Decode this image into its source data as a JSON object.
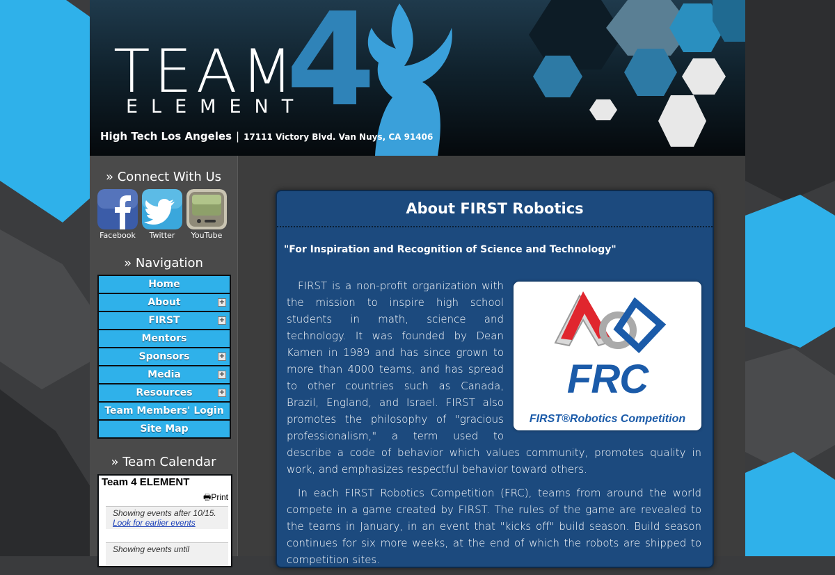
{
  "header": {
    "brand_team": "TEAM",
    "brand_number": "4",
    "brand_element": "ELEMENT",
    "school": "High Tech Los Angeles",
    "separator": "|",
    "address": "17111 Victory Blvd. Van Nuys, CA 91406"
  },
  "sidebar": {
    "connect_heading": "» Connect With Us",
    "social": [
      {
        "label": "Facebook",
        "icon": "facebook-icon"
      },
      {
        "label": "Twitter",
        "icon": "twitter-icon"
      },
      {
        "label": "YouTube",
        "icon": "youtube-icon"
      }
    ],
    "nav_heading": "» Navigation",
    "nav": [
      {
        "label": "Home",
        "expandable": false
      },
      {
        "label": "About",
        "expandable": true
      },
      {
        "label": "FIRST",
        "expandable": true
      },
      {
        "label": "Mentors",
        "expandable": false
      },
      {
        "label": "Sponsors",
        "expandable": true
      },
      {
        "label": "Media",
        "expandable": true
      },
      {
        "label": "Resources",
        "expandable": true
      },
      {
        "label": "Team Members' Login",
        "expandable": false
      },
      {
        "label": "Site Map",
        "expandable": false
      }
    ],
    "expand_symbol": "+",
    "calendar_heading": "» Team Calendar",
    "calendar": {
      "title": "Team 4 ELEMENT",
      "print_label": "Print",
      "after_text": "Showing events after 10/15.",
      "earlier_link": "Look for earlier events",
      "until_text": "Showing events until"
    }
  },
  "content": {
    "title": "About FIRST Robotics",
    "quote": "\"For Inspiration and Recognition of Science and Technology\"",
    "paragraph1": "FIRST is a non-profit organization with the mission to inspire high school students in math, science and technology. It was founded by Dean Kamen in 1989 and has since grown to more than 4000 teams, and has spread to other countries such as Canada, Brazil, England, and Israel. FIRST also promotes the philosophy of \"gracious professionalism,\" a term used to describe a code of behavior which values community, promotes quality in work, and emphasizes respectful behavior toward others.",
    "paragraph2": "In each FIRST Robotics Competition (FRC), teams from around the world compete in a game created by FIRST. The rules of the game are revealed to the teams in January, in an event that \"kicks off\" build season. Build season continues for six more weeks, at the end of which the robots are shipped to competition sites.",
    "frc_logo": {
      "word": "FRC",
      "sub": "FIRST®Robotics Competition"
    }
  },
  "colors": {
    "accent": "#2fb1ea",
    "panel": "#1c4a7e",
    "brand_blue": "#2f83b8"
  }
}
